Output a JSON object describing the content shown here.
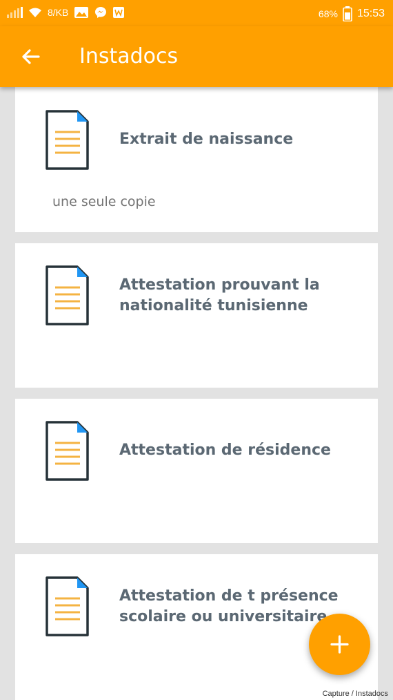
{
  "status_bar": {
    "network_speed": "8/KB",
    "battery": "68%",
    "time": "15:53"
  },
  "app_bar": {
    "title": "Instadocs"
  },
  "documents": [
    {
      "title": "Extrait de naissance",
      "subtitle": "une seule copie"
    },
    {
      "title": "Attestation prouvant la nationalité tunisienne",
      "subtitle": ""
    },
    {
      "title": "Attestation de résidence",
      "subtitle": ""
    },
    {
      "title": "Attestation de t présence scolaire ou universitaire",
      "subtitle": ""
    }
  ],
  "fab": {
    "label": "+"
  },
  "caption": "Capture / Instadocs",
  "colors": {
    "accent": "#ffa000",
    "doc_lines": "#f4b342",
    "doc_corner": "#2196f3",
    "title_text": "#5b6873"
  }
}
